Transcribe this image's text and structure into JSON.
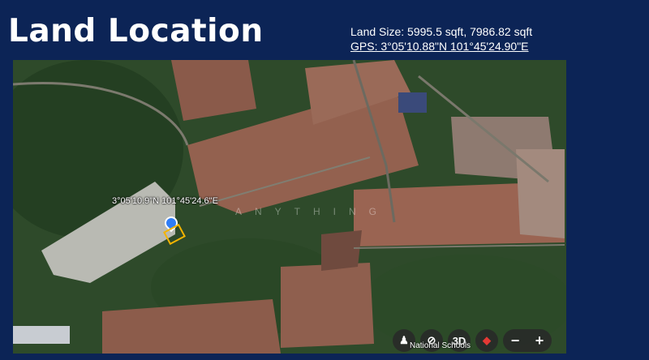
{
  "slide": {
    "title": "Land Location",
    "land_size": "Land Size: 5995.5 sqft, 7986.82 sqft",
    "gps": "GPS: 3°05'10.88\"N 101°45'24.90\"E"
  },
  "map": {
    "coord_label": "3°05'10.9\"N 101°45'24.6\"E",
    "watermark": "ANYTHING",
    "place_label": "National Schools",
    "controls": {
      "view_3d": "3D",
      "zoom_out": "−",
      "zoom_in": "+"
    },
    "pin_color": "#2f7df6",
    "plot_outline_color": "#f4b400"
  },
  "colors": {
    "background": "#0c2456",
    "text": "#ffffff"
  }
}
